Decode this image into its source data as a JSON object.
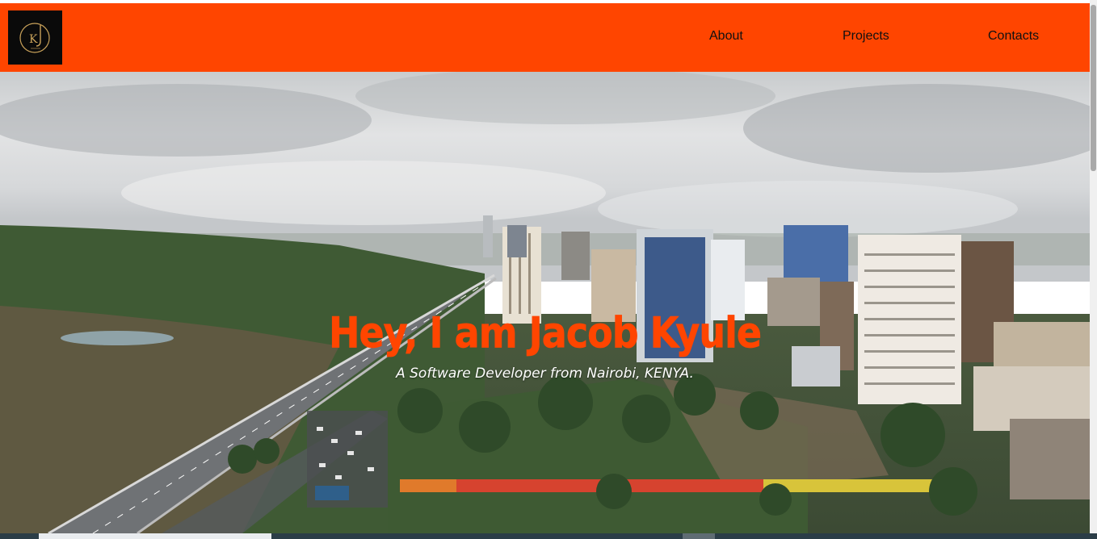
{
  "nav": {
    "logo_text": "KJ",
    "links": [
      {
        "label": "About"
      },
      {
        "label": "Projects"
      },
      {
        "label": "Contacts"
      }
    ]
  },
  "hero": {
    "title": "Hey, I am Jacob Kyule",
    "subtitle": "A Software Developer from Nairobi, KENYA.",
    "background_image": "aerial-city-skyline-nairobi"
  },
  "colors": {
    "brand": "#ff4500",
    "logo_bg": "#0a0a0a",
    "logo_accent": "#c9a25a",
    "nav_text": "#111111",
    "subtitle_text": "#ffffff"
  }
}
